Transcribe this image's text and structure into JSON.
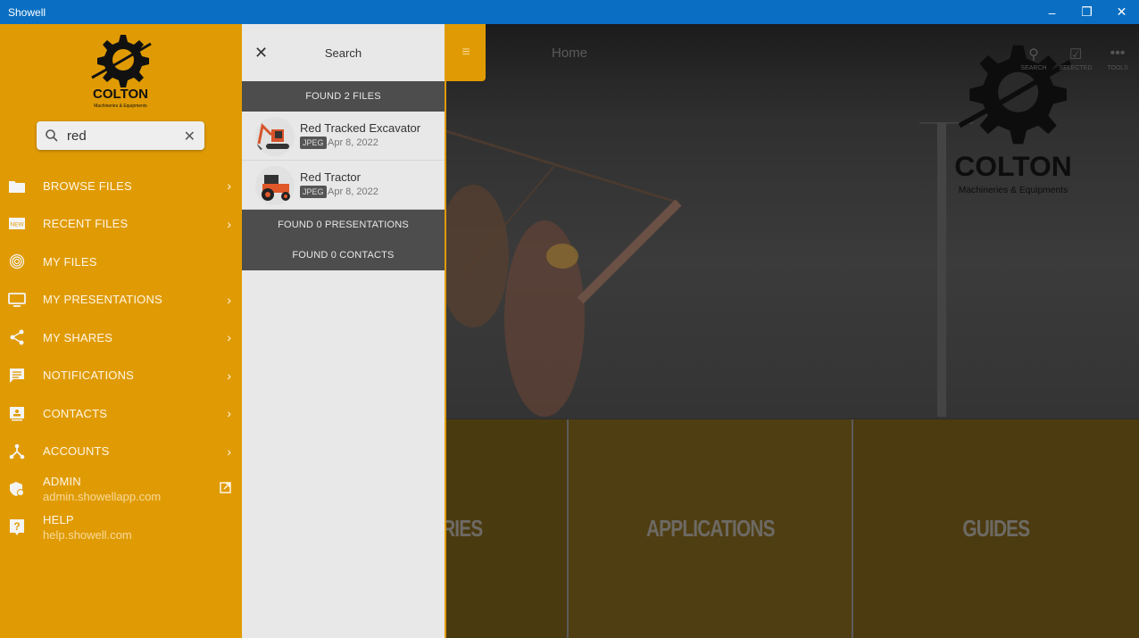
{
  "window": {
    "title": "Showell",
    "controls": {
      "minimize": "–",
      "restore": "❐",
      "close": "✕"
    }
  },
  "sidebar": {
    "brand": {
      "name": "COLTON",
      "tagline": "Machineries & Equipments"
    },
    "search": {
      "value": "red",
      "placeholder": "Search",
      "clear_icon": "✕"
    },
    "items": [
      {
        "label": "BROWSE FILES",
        "icon": "folder-icon",
        "chevron": true
      },
      {
        "label": "RECENT FILES",
        "icon": "new-badge-icon",
        "chevron": true
      },
      {
        "label": "MY FILES",
        "icon": "fingerprint-icon",
        "chevron": false
      },
      {
        "label": "MY PRESENTATIONS",
        "icon": "monitor-icon",
        "chevron": true
      },
      {
        "label": "MY SHARES",
        "icon": "share-icon",
        "chevron": true
      },
      {
        "label": "NOTIFICATIONS",
        "icon": "message-icon",
        "chevron": true
      },
      {
        "label": "CONTACTS",
        "icon": "contact-card-icon",
        "chevron": true
      },
      {
        "label": "ACCOUNTS",
        "icon": "accounts-icon",
        "chevron": true
      },
      {
        "label": "ADMIN",
        "sub": "admin.showellapp.com",
        "icon": "shield-icon",
        "external": true
      },
      {
        "label": "HELP",
        "sub": "help.showell.com",
        "icon": "help-icon"
      }
    ],
    "chevron_glyph": "›",
    "external_glyph": "⧉"
  },
  "search_panel": {
    "title": "Search",
    "close_icon": "✕",
    "files_header": "FOUND 2 FILES",
    "results": [
      {
        "name": "Red Tracked Excavator",
        "type": "JPEG",
        "date": "Apr 8, 2022"
      },
      {
        "name": "Red Tractor",
        "type": "JPEG",
        "date": "Apr 8, 2022"
      }
    ],
    "presentations_header": "FOUND 0 PRESENTATIONS",
    "contacts_header": "FOUND 0 CONTACTS"
  },
  "main": {
    "menu_icon": "≡",
    "page_title": "Home",
    "toolbar": [
      {
        "label": "SEARCH",
        "glyph": "⚲"
      },
      {
        "label": "SELECTED",
        "glyph": "☑"
      },
      {
        "label": "TOOLS",
        "glyph": "•••"
      }
    ],
    "brand": {
      "name": "COLTON",
      "tagline": "Machineries & Equipments"
    },
    "tiles": [
      {
        "label": "ACCESSORIES"
      },
      {
        "label": "APPLICATIONS"
      },
      {
        "label": "GUIDES"
      }
    ]
  },
  "colors": {
    "brand": "#e09b04",
    "titlebar": "#0a6fc2",
    "section": "#4d4d4d"
  }
}
